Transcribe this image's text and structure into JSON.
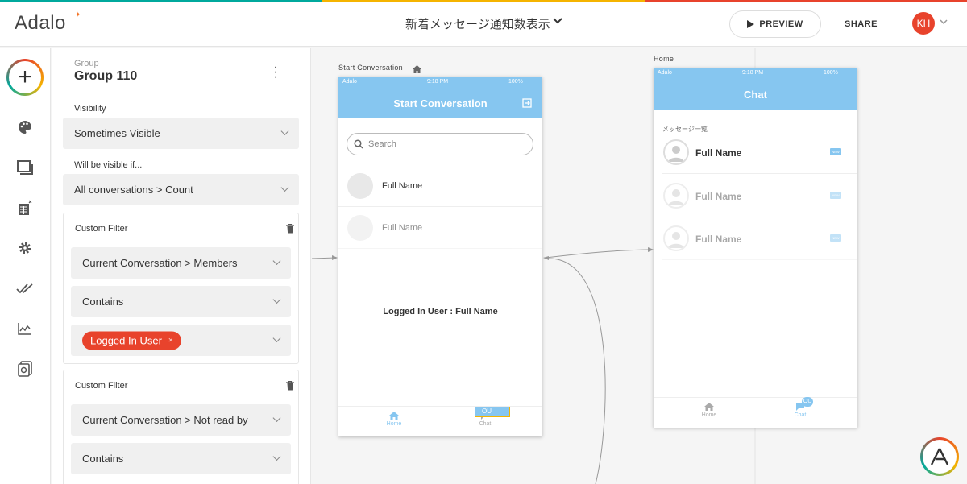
{
  "app": {
    "logo": "Adalo",
    "title": "新着メッセージ通知数表示",
    "preview_label": "PREVIEW",
    "share_label": "SHARE",
    "user_initials": "KH"
  },
  "colors": {
    "accent": "#e8432c",
    "header_blue": "#86c6f0",
    "strip": [
      "#00a99d",
      "#f5b400",
      "#e8432c"
    ]
  },
  "rail": {
    "icons": [
      "add-icon",
      "palette-icon",
      "screens-icon",
      "database-icon",
      "settings-icon",
      "publish-icon",
      "analytics-icon",
      "marketplace-icon"
    ]
  },
  "panel": {
    "group_label": "Group",
    "group_name": "Group 110",
    "visibility_label": "Visibility",
    "visibility_value": "Sometimes Visible",
    "visible_if_label": "Will be visible if...",
    "visible_if_value": "All conversations > Count",
    "filters": [
      {
        "title": "Custom Filter",
        "field": "Current Conversation > Members",
        "operator": "Contains",
        "value_chip": "Logged In User"
      },
      {
        "title": "Custom Filter",
        "field": "Current Conversation > Not read by",
        "operator": "Contains"
      }
    ]
  },
  "screens": {
    "start": {
      "label": "Start Conversation",
      "status_carrier": "Adalo",
      "status_time": "9:18 PM",
      "status_battery": "100%",
      "header": "Start Conversation",
      "search_placeholder": "Search",
      "rows": [
        "Full Name",
        "Full Name"
      ],
      "center_text": "Logged In User : Full Name",
      "tabs": [
        "Home",
        "Chat"
      ],
      "chat_badge": "OU"
    },
    "home": {
      "label": "Home",
      "status_carrier": "Adalo",
      "status_time": "9:18 PM",
      "status_battery": "100%",
      "header": "Chat",
      "list_label": "メッセージ一覧",
      "rows": [
        "Full Name",
        "Full Name",
        "Full Name"
      ],
      "badge": "NEW",
      "tabs": [
        "Home",
        "Chat"
      ],
      "chat_badge": "OU"
    }
  }
}
